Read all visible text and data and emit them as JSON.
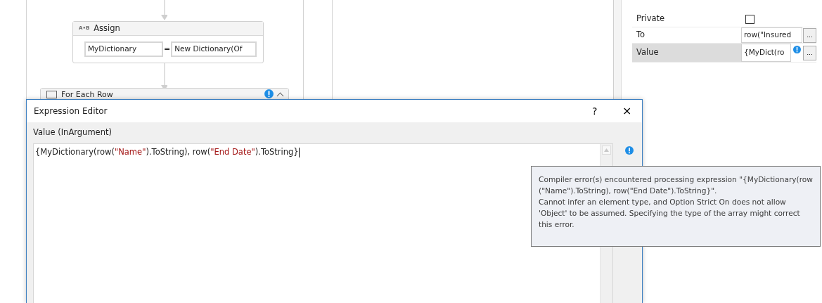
{
  "designer": {
    "assign": {
      "icon": "A•B",
      "title": "Assign",
      "to": "MyDictionary",
      "operator": "=",
      "value": "New Dictionary(Of"
    },
    "for_each": {
      "title": "For Each Row",
      "has_warning": true
    }
  },
  "properties": {
    "rows": [
      {
        "label": "Private",
        "kind": "checkbox",
        "checked": false,
        "selected": false
      },
      {
        "label": "To",
        "kind": "expression",
        "value": "row(\"Insured",
        "has_warning": false,
        "button": "...",
        "selected": false
      },
      {
        "label": "Value",
        "kind": "expression",
        "value": "{MyDict(ro",
        "has_warning": true,
        "button": "...",
        "selected": true
      }
    ]
  },
  "dialog": {
    "title": "Expression Editor",
    "help": "?",
    "close": "×",
    "label": "Value (InArgument)",
    "has_warning": true,
    "expression": [
      {
        "kind": "code",
        "text": "{MyDictionary(row("
      },
      {
        "kind": "string",
        "text": "\"Name\""
      },
      {
        "kind": "code",
        "text": ").ToString), row("
      },
      {
        "kind": "string",
        "text": "\"End Date\""
      },
      {
        "kind": "code",
        "text": ").ToString}"
      }
    ]
  },
  "tooltip": {
    "lines": [
      "Compiler error(s) encountered processing expression \"{MyDictionary(row (\"Name\").ToString), row(\"End Date\").ToString}\".",
      "Cannot infer an element type, and Option Strict On does not allow 'Object' to be assumed. Specifying the type of the array might correct this error."
    ]
  }
}
